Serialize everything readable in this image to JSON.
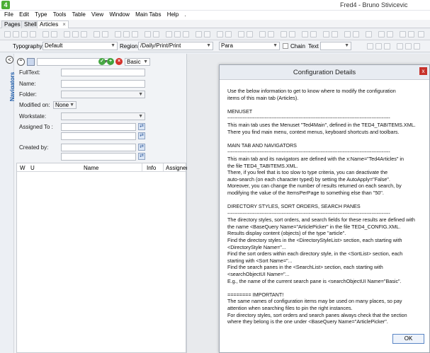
{
  "window": {
    "title": "Fred4 - Bruno Stivicevic",
    "app_icon": "4"
  },
  "menubar": [
    "File",
    "Edit",
    "Type",
    "Tools",
    "Table",
    "View",
    "Window",
    "Main Tabs",
    "Help",
    "."
  ],
  "tabs": [
    {
      "label": "Pages"
    },
    {
      "label": "Shell"
    },
    {
      "label": "Articles",
      "close": "×"
    }
  ],
  "formatbar": {
    "typography_label": "Typography",
    "typography_value": "Default",
    "region_label": "Region",
    "region_value": "/Daily/Print/Print",
    "para_value": "Para",
    "chain_label": "Chain",
    "text_label": "Text"
  },
  "navigator": {
    "label": "Navigators",
    "back": "<"
  },
  "search": {
    "basic_value": "Basic",
    "fulltext_label": "FullText:",
    "name_label": "Name:",
    "folder_label": "Folder:",
    "modified_label": "Modified on:",
    "modified_value": "None",
    "workstate_label": "Workstate:",
    "assigned_label": "Assigned To :",
    "created_label": "Created by:"
  },
  "results": {
    "columns": [
      "W",
      "U",
      "Name",
      "Info",
      "Assigned"
    ]
  },
  "dialog": {
    "title": "Configuration Details",
    "close": "x",
    "ok_label": "OK",
    "lines": [
      "Use the below information to get to know where to modify the configuration",
      "items of this main tab (Articles).",
      "",
      "MENUSET",
      "------------------------------------------------------------------------------------------------",
      "This main tab uses the Menuset \"Ted4Main\", defined in the TED4_TABITEMS.XML.",
      "There you find main menu, context menus, keyboard shortcuts and toolbars.",
      "",
      "MAIN TAB AND NAVIGATORS",
      "------------------------------------------------------------------------------------------------",
      "This main tab and its navigators are defined with the x:Name=\"Ted4Articles\" in",
      "the file TED4_TABITEMS.XML.",
      "There, if you feel that is too slow to type criteria, you can deactivate the",
      "auto-search (on each character typed) by setting the AutoApply=\"False\".",
      "Moreover, you can change the number of results returned on each search, by",
      "modifying the value of the ItemsPerPage to something else than \"50\".",
      "",
      "DIRECTORY STYLES, SORT ORDERS, SEARCH PANES",
      "------------------------------------------------------------------------------------------------",
      "The directory styles, sort orders, and search fields for these results are defined with",
      "the name <BaseQuery Name=\"ArticlePicker\" in the file TED4_CONFIG.XML.",
      "Results display content (objects) of the type \"article\".",
      "Find the directory styles in the <DirectoryStyleList> section, each starting with",
      "<DirectoryStyle Name=\"...",
      "Find the sort orders within each directory style, in the <SortList> section, each",
      "starting with <Sort Name=\"...",
      "Find the search panes in the <SearchList> section, each starting with",
      "<searchObjectUI Name=\"...",
      "E.g., the name of the current search pane is <searchObjectUI Name=\"Basic\".",
      "",
      "======== IMPORTANT!",
      "The same names of configuration items may be used on many places, so pay",
      "attention when searching files to pin the right instances.",
      "For directory styles, sort orders and search panes always check that the section",
      "where they belong is the one under <BaseQuery Name=\"ArticlePicker\"."
    ]
  }
}
